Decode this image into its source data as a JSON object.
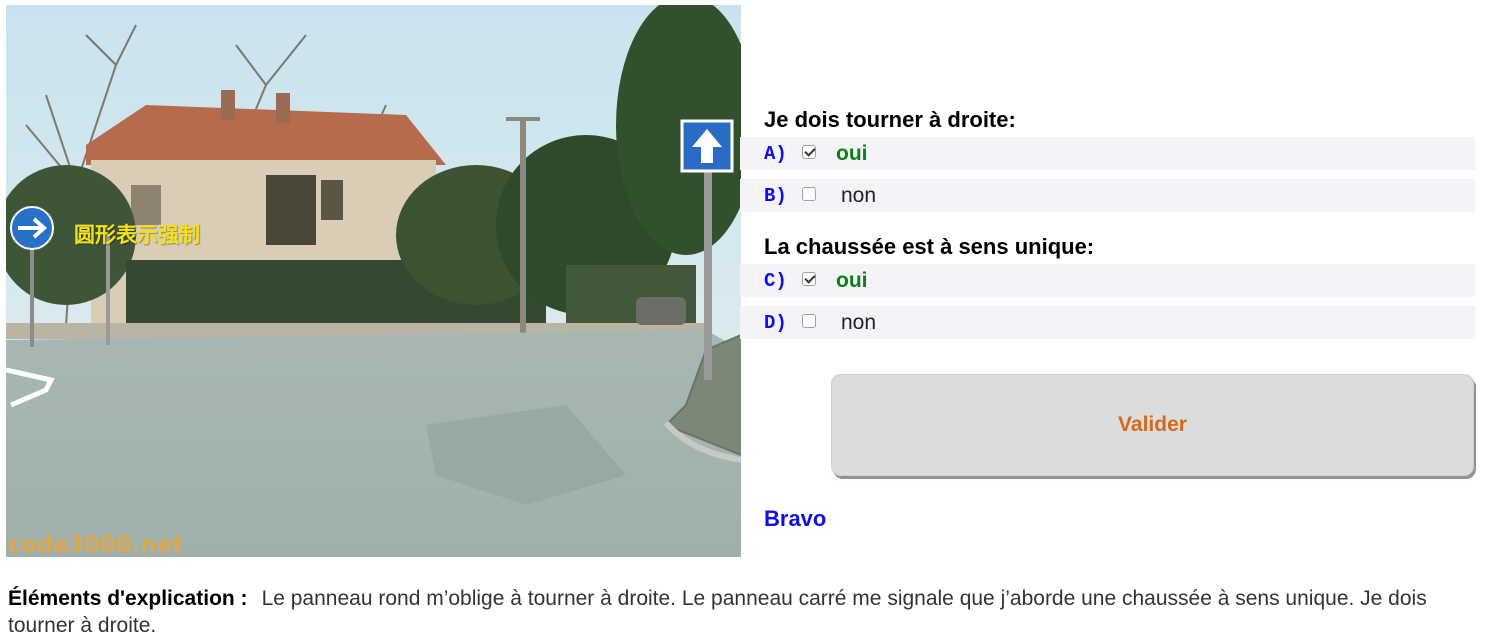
{
  "scene": {
    "caption": "圆形表示强制",
    "watermark": "code3000.net",
    "signs": [
      "arrow-right-sign-icon",
      "one-way-up-sign-icon"
    ]
  },
  "questions": [
    {
      "text": "Je dois tourner à droite:",
      "answers": [
        {
          "letter": "A)",
          "checked": true,
          "text": "oui",
          "status": "correct"
        },
        {
          "letter": "B)",
          "checked": false,
          "text": "non",
          "status": "plain"
        }
      ]
    },
    {
      "text": "La chaussée est à sens unique:",
      "answers": [
        {
          "letter": "C)",
          "checked": true,
          "text": "oui",
          "status": "correct"
        },
        {
          "letter": "D)",
          "checked": false,
          "text": "non",
          "status": "plain"
        }
      ]
    }
  ],
  "validate_label": "Valider",
  "result": "Bravo",
  "explanation": {
    "label": "Éléments d'explication :",
    "text": "Le panneau rond m’oblige à tourner à droite. Le panneau carré me signale que j’aborde une chaussée à sens unique. Je dois tourner à droite."
  },
  "colors": {
    "answer_letter": "#1010e0",
    "correct": "#0e7d1c",
    "validate_text": "#d26a1e",
    "result": "#1010e0",
    "row_bg": "#f4f4f8"
  }
}
